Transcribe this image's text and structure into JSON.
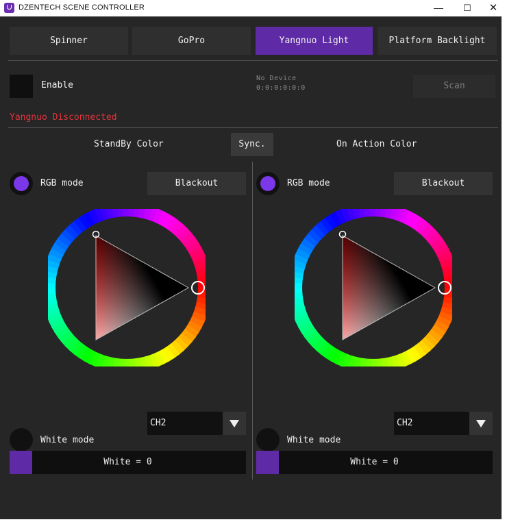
{
  "window": {
    "title": "DZENTECH SCENE CONTROLLER",
    "minimize_glyph": "—",
    "maximize_glyph": "☐",
    "close_glyph": "✕"
  },
  "tabs": [
    {
      "label": "Spinner",
      "active": false
    },
    {
      "label": "GoPro",
      "active": false
    },
    {
      "label": "Yangnuo Light",
      "active": true
    },
    {
      "label": "Platform Backlight",
      "active": false
    }
  ],
  "device": {
    "enable_label": "Enable",
    "name": "No Device",
    "address": "0:0:0:0:0:0",
    "scan_label": "Scan",
    "status": "Yangnuo Disconnected"
  },
  "colors": {
    "accent": "#5e2aa5",
    "radio_dot": "#7b38e8",
    "status_error": "#e2333a",
    "selected_hue": "#ff0000"
  },
  "sync_label": "Sync.",
  "panels": [
    {
      "title": "StandBy Color",
      "rgb_mode_label": "RGB mode",
      "rgb_mode_selected": true,
      "blackout_label": "Blackout",
      "white_mode_label": "White mode",
      "white_mode_selected": false,
      "channel": "CH2",
      "white_text": "White = 0",
      "white_value": 0
    },
    {
      "title": "On Action Color",
      "rgb_mode_label": "RGB mode",
      "rgb_mode_selected": true,
      "blackout_label": "Blackout",
      "white_mode_label": "White mode",
      "white_mode_selected": false,
      "channel": "CH2",
      "white_text": "White = 0",
      "white_value": 0
    }
  ]
}
